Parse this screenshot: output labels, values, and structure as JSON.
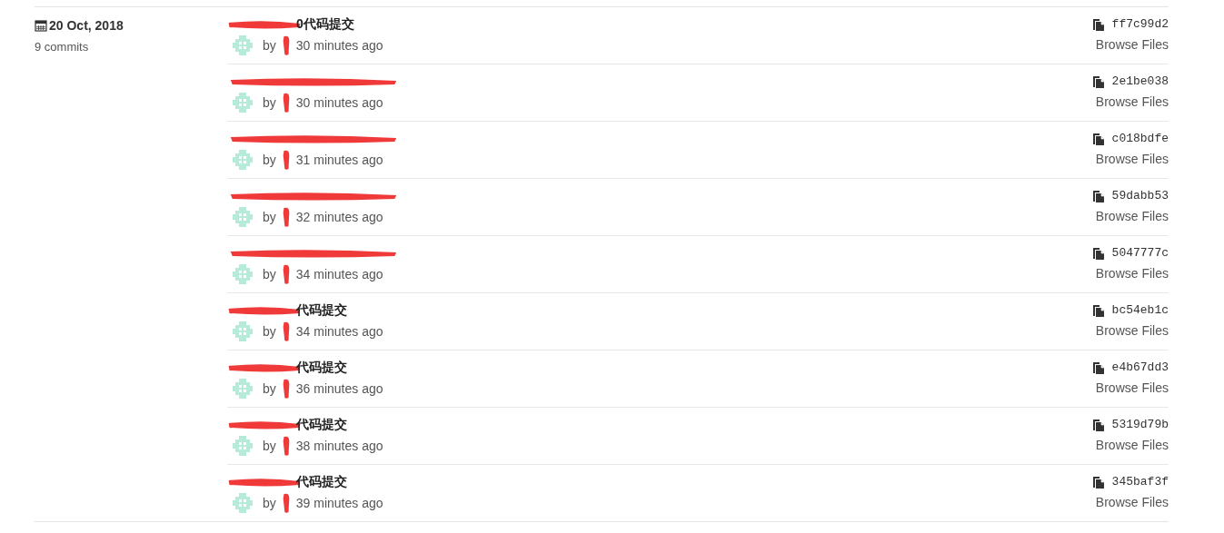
{
  "day": {
    "date": "20 Oct, 2018",
    "count": "9 commits"
  },
  "commits": [
    {
      "title": "0代码提交",
      "by": "by",
      "time": "30 minutes ago",
      "hash": "ff7c99d2",
      "browse": "Browse Files"
    },
    {
      "by": "by",
      "time": "30 minutes ago",
      "hash": "2e1be038",
      "browse": "Browse Files"
    },
    {
      "by": "by",
      "time": "31 minutes ago",
      "hash": "c018bdfe",
      "browse": "Browse Files"
    },
    {
      "by": "by",
      "time": "32 minutes ago",
      "hash": "59dabb53",
      "browse": "Browse Files"
    },
    {
      "by": "by",
      "time": "34 minutes ago",
      "hash": "5047777c",
      "browse": "Browse Files"
    },
    {
      "title": "代码提交",
      "by": "by",
      "time": "34 minutes ago",
      "hash": "bc54eb1c",
      "browse": "Browse Files"
    },
    {
      "title": "代码提交",
      "by": "by",
      "time": "36 minutes ago",
      "hash": "e4b67dd3",
      "browse": "Browse Files"
    },
    {
      "title": "代码提交",
      "by": "by",
      "time": "38 minutes ago",
      "hash": "5319d79b",
      "browse": "Browse Files"
    },
    {
      "title": "代码提交",
      "by": "by",
      "time": "39 minutes ago",
      "hash": "345baf3f",
      "browse": "Browse Files"
    }
  ]
}
